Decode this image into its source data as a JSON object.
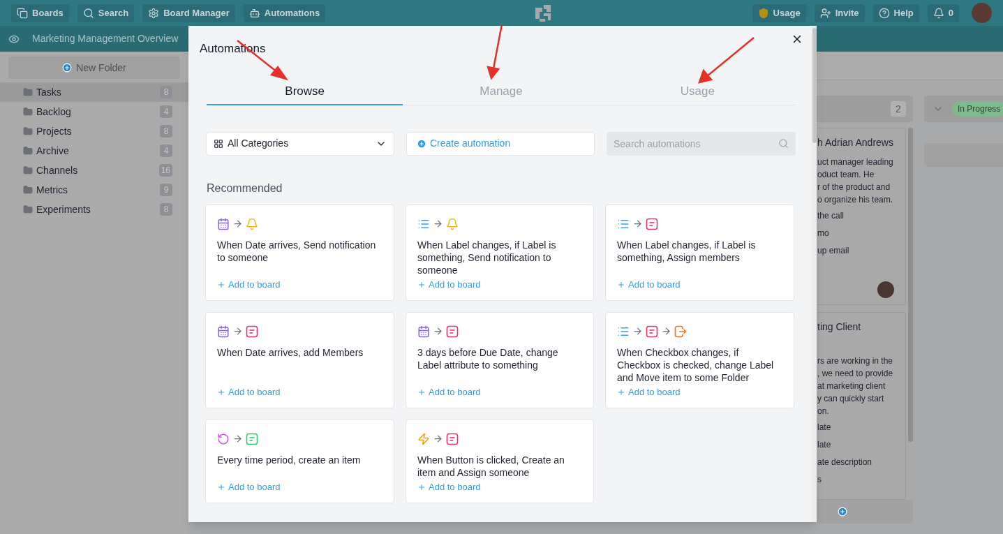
{
  "top_bar": {
    "left_buttons": [
      {
        "label": "Boards"
      },
      {
        "label": "Search"
      },
      {
        "label": "Board Manager"
      },
      {
        "label": "Automations"
      }
    ],
    "right_buttons": [
      {
        "label": "Usage"
      },
      {
        "label": "Invite"
      },
      {
        "label": "Help"
      },
      {
        "label": "0"
      }
    ]
  },
  "sub_bar": {
    "title": "Marketing Management Overview"
  },
  "sidebar": {
    "new_folder": "New Folder",
    "folders": [
      {
        "name": "Tasks",
        "count": "8",
        "selected": true
      },
      {
        "name": "Backlog",
        "count": "4",
        "selected": false
      },
      {
        "name": "Projects",
        "count": "8",
        "selected": false
      },
      {
        "name": "Archive",
        "count": "4",
        "selected": false
      },
      {
        "name": "Channels",
        "count": "16",
        "selected": false
      },
      {
        "name": "Metrics",
        "count": "9",
        "selected": false
      },
      {
        "name": "Experiments",
        "count": "8",
        "selected": false
      }
    ]
  },
  "board": {
    "column_1": {
      "count": "2",
      "cards": [
        {
          "title": "h Adrian Andrews",
          "paragraph": [
            "uct manager leading",
            "oduct team. He",
            "r of the product and",
            "o organize his team."
          ],
          "items": [
            "the call",
            "mo",
            "up email"
          ],
          "avatar": true
        },
        {
          "title": "ting Client",
          "paragraph": [
            "rs are working in the",
            ", we need to provide",
            "at marketing client",
            "y can quickly start",
            "on."
          ],
          "items": [
            "late",
            "late",
            "ate description",
            "s"
          ],
          "avatar": false
        }
      ]
    },
    "column_2": {
      "status": "In Progress"
    }
  },
  "modal": {
    "title": "Automations",
    "tabs": [
      {
        "label": "Browse",
        "selected": true
      },
      {
        "label": "Manage",
        "selected": false
      },
      {
        "label": "Usage",
        "selected": false
      }
    ],
    "category_select": "All Categories",
    "create_button": "Create automation",
    "search": {
      "placeholder": "Search automations"
    },
    "section_title": "Recommended",
    "automations": [
      {
        "steps": [
          {
            "kind": "calendar"
          },
          {
            "kind": "bell"
          }
        ],
        "text": "When Date arrives, Send notification to someone",
        "action": "Add to board"
      },
      {
        "steps": [
          {
            "kind": "list"
          },
          {
            "kind": "bell"
          }
        ],
        "text": "When Label changes, if Label is something, Send notification to someone",
        "action": "Add to board"
      },
      {
        "steps": [
          {
            "kind": "list"
          },
          {
            "kind": "form"
          }
        ],
        "text": "When Label changes, if Label is something, Assign members",
        "action": "Add to board"
      },
      {
        "steps": [
          {
            "kind": "calendar"
          },
          {
            "kind": "form"
          }
        ],
        "text": "When Date arrives, add Members",
        "action": "Add to board"
      },
      {
        "steps": [
          {
            "kind": "calendar"
          },
          {
            "kind": "form"
          }
        ],
        "text": "3 days before Due Date, change Label attribute to something",
        "action": "Add to board"
      },
      {
        "steps": [
          {
            "kind": "list"
          },
          {
            "kind": "form"
          },
          {
            "kind": "move"
          }
        ],
        "text": "When Checkbox changes, if Checkbox is checked, change Label and Move item to some Folder",
        "action": "Add to board"
      },
      {
        "steps": [
          {
            "kind": "loop"
          },
          {
            "kind": "item"
          }
        ],
        "text": "Every time period, create an item",
        "action": "Add to board"
      },
      {
        "steps": [
          {
            "kind": "bolt"
          },
          {
            "kind": "form"
          }
        ],
        "text": "When Button is clicked, Create an item and Assign someone",
        "action": "Add to board"
      }
    ]
  }
}
